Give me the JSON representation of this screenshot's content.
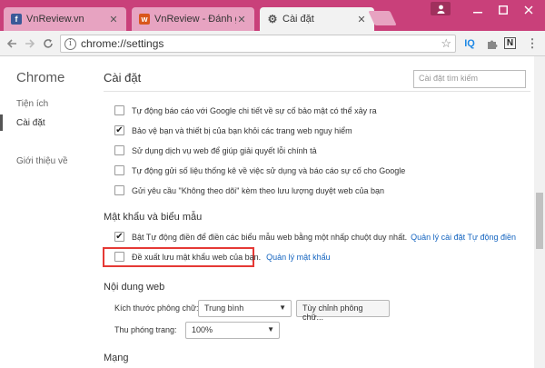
{
  "tabs": [
    {
      "title": "VnReview.vn",
      "favicon": "facebook-icon",
      "active": false
    },
    {
      "title": "VnReview - Đánh giá, tin",
      "favicon": "vnreview-icon",
      "active": false
    },
    {
      "title": "Cài đặt",
      "favicon": "gear-icon",
      "active": true
    }
  ],
  "toolbar": {
    "url": "chrome://settings",
    "extensions": [
      "IQ",
      "N"
    ]
  },
  "sidebar": {
    "title": "Chrome",
    "items": [
      {
        "label": "Tiện ích"
      },
      {
        "label": "Cài đặt",
        "selected": true
      },
      {
        "label": "Giới thiệu về"
      }
    ]
  },
  "main": {
    "title": "Cài đặt",
    "search_placeholder": "Cài đặt tìm kiếm",
    "privacy_items": [
      {
        "label": "Tự động báo cáo với Google chi tiết về sự cố bảo mật có thể xảy ra",
        "checked": false
      },
      {
        "label": "Bảo vệ bạn và thiết bị của bạn khỏi các trang web nguy hiểm",
        "checked": true
      },
      {
        "label": "Sử dụng dịch vụ web để giúp giải quyết lỗi chính tả",
        "checked": false
      },
      {
        "label": "Tự động gửi số liệu thống kê về việc sử dụng và báo cáo sự cố cho Google",
        "checked": false
      },
      {
        "label": "Gửi yêu cầu \"Không theo dõi\" kèm theo lưu lượng duyệt web của bạn",
        "checked": false
      }
    ],
    "passwords": {
      "heading": "Mật khẩu và biểu mẫu",
      "autofill_label": "Bật Tự động điền để điền các biểu mẫu web bằng một nhấp chuột duy nhất.",
      "autofill_checked": true,
      "autofill_link": "Quản lý cài đặt Tự động điền",
      "offer_save_label": "Đề xuất lưu mật khẩu web của bạn.",
      "offer_save_checked": false,
      "manage_passwords_link": "Quản lý mật khẩu"
    },
    "web_content": {
      "heading": "Nội dung web",
      "font_size_label": "Kích thước phông chữ:",
      "font_size_value": "Trung bình",
      "customize_fonts_button": "Tùy chỉnh phông chữ...",
      "zoom_label": "Thu phóng trang:",
      "zoom_value": "100%"
    },
    "network": {
      "heading": "Mạng"
    }
  },
  "colors": {
    "titlebar": "#c9407a",
    "link": "#1565c0",
    "highlight": "#e53935"
  }
}
